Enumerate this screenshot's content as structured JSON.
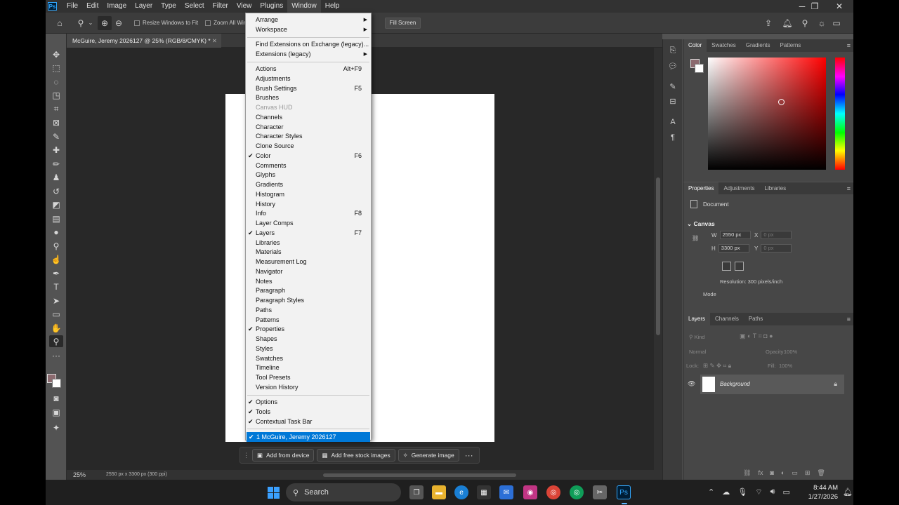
{
  "menubar": {
    "logo": "Ps",
    "items": [
      "File",
      "Edit",
      "Image",
      "Layer",
      "Type",
      "Select",
      "Filter",
      "View",
      "Plugins",
      "Window",
      "Help"
    ],
    "active_item": "Window"
  },
  "options": {
    "resize_windows_label": "Resize Windows to Fit",
    "zoom_all_label": "Zoom All Win",
    "fill_screen_label": "Fill Screen"
  },
  "document": {
    "tab_title": "McGuire, Jeremy 2026127 @ 25% (RGB/8/CMYK) *",
    "zoom": "25%",
    "dimensions": "2550 px x 3300 px (300 ppi)"
  },
  "window_menu": {
    "items": [
      {
        "label": "Arrange",
        "submenu": true
      },
      {
        "label": "Workspace",
        "submenu": true
      },
      {
        "sep": true
      },
      {
        "label": "Find Extensions on Exchange (legacy)..."
      },
      {
        "label": "Extensions (legacy)",
        "submenu": true
      },
      {
        "sep": true
      },
      {
        "label": "Actions",
        "shortcut": "Alt+F9"
      },
      {
        "label": "Adjustments"
      },
      {
        "label": "Brush Settings",
        "shortcut": "F5"
      },
      {
        "label": "Brushes"
      },
      {
        "label": "Canvas HUD",
        "disabled": true
      },
      {
        "label": "Channels"
      },
      {
        "label": "Character"
      },
      {
        "label": "Character Styles"
      },
      {
        "label": "Clone Source"
      },
      {
        "label": "Color",
        "shortcut": "F6",
        "checked": true
      },
      {
        "label": "Comments"
      },
      {
        "label": "Glyphs"
      },
      {
        "label": "Gradients"
      },
      {
        "label": "Histogram"
      },
      {
        "label": "History"
      },
      {
        "label": "Info",
        "shortcut": "F8"
      },
      {
        "label": "Layer Comps"
      },
      {
        "label": "Layers",
        "shortcut": "F7",
        "checked": true
      },
      {
        "label": "Libraries"
      },
      {
        "label": "Materials"
      },
      {
        "label": "Measurement Log"
      },
      {
        "label": "Navigator"
      },
      {
        "label": "Notes"
      },
      {
        "label": "Paragraph"
      },
      {
        "label": "Paragraph Styles"
      },
      {
        "label": "Paths"
      },
      {
        "label": "Patterns"
      },
      {
        "label": "Properties",
        "checked": true
      },
      {
        "label": "Shapes"
      },
      {
        "label": "Styles"
      },
      {
        "label": "Swatches"
      },
      {
        "label": "Timeline"
      },
      {
        "label": "Tool Presets"
      },
      {
        "label": "Version History"
      },
      {
        "sep": true
      },
      {
        "label": "Options",
        "checked": true
      },
      {
        "label": "Tools",
        "checked": true
      },
      {
        "label": "Contextual Task Bar",
        "checked": true
      },
      {
        "sep": true
      },
      {
        "label": "1 McGuire, Jeremy 2026127",
        "checked": true,
        "highlighted": true
      }
    ]
  },
  "context_bar": {
    "add_device": "Add from device",
    "add_stock": "Add free stock images",
    "generate": "Generate image",
    "more": "···"
  },
  "color_panel": {
    "tabs": [
      "Color",
      "Swatches",
      "Gradients",
      "Patterns"
    ],
    "foreground": "#8b6a6f",
    "background": "#ffffff"
  },
  "properties_panel": {
    "tabs": [
      "Properties",
      "Adjustments",
      "Libraries"
    ],
    "doc_label": "Document",
    "canvas_label": "Canvas",
    "w_label": "W",
    "w_value": "2550 px",
    "h_label": "H",
    "h_value": "3300 px",
    "x_label": "X",
    "x_value": "0 px",
    "y_label": "Y",
    "y_value": "0 px",
    "resolution": "Resolution: 300 pixels/inch",
    "mode_label": "Mode"
  },
  "layers_panel": {
    "tabs": [
      "Layers",
      "Channels",
      "Paths"
    ],
    "kind": "Kind",
    "blend_mode": "Normal",
    "opacity_label": "Opacity:",
    "opacity_value": "100%",
    "lock_label": "Lock:",
    "fill_label": "Fill:",
    "fill_value": "100%",
    "layer_name": "Background"
  },
  "taskbar": {
    "search_label": "Search",
    "time": "8:44 AM",
    "date": "1/27/2026"
  }
}
